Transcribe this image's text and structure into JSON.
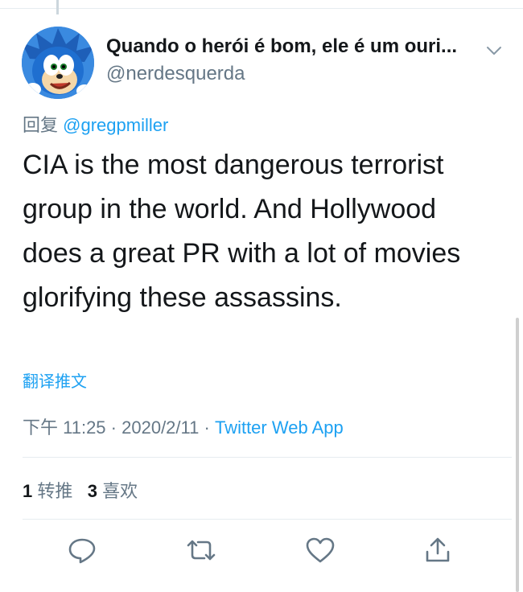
{
  "tweet": {
    "display_name": "Quando o herói é bom, ele é um ouri...",
    "handle": "@nerdesquerda",
    "reply_prefix": "回复",
    "reply_mention": "@gregpmiller",
    "text": "CIA is the most dangerous terrorist group in the world. And Hollywood does a great PR with a lot of movies glorifying these assassins.",
    "translate_label": "翻译推文",
    "time": "下午 11:25",
    "separator": "·",
    "date": "2020/2/11",
    "source": "Twitter Web App",
    "retweet_count": "1",
    "retweet_label": "转推",
    "like_count": "3",
    "like_label": "喜欢"
  },
  "icons": {
    "more": "chevron-down-icon",
    "reply": "reply-icon",
    "retweet": "retweet-icon",
    "like": "like-icon",
    "share": "share-icon"
  },
  "colors": {
    "accent": "#1da1f2",
    "secondary_text": "#657786",
    "primary_text": "#14171a",
    "icon_gray": "#657786"
  }
}
